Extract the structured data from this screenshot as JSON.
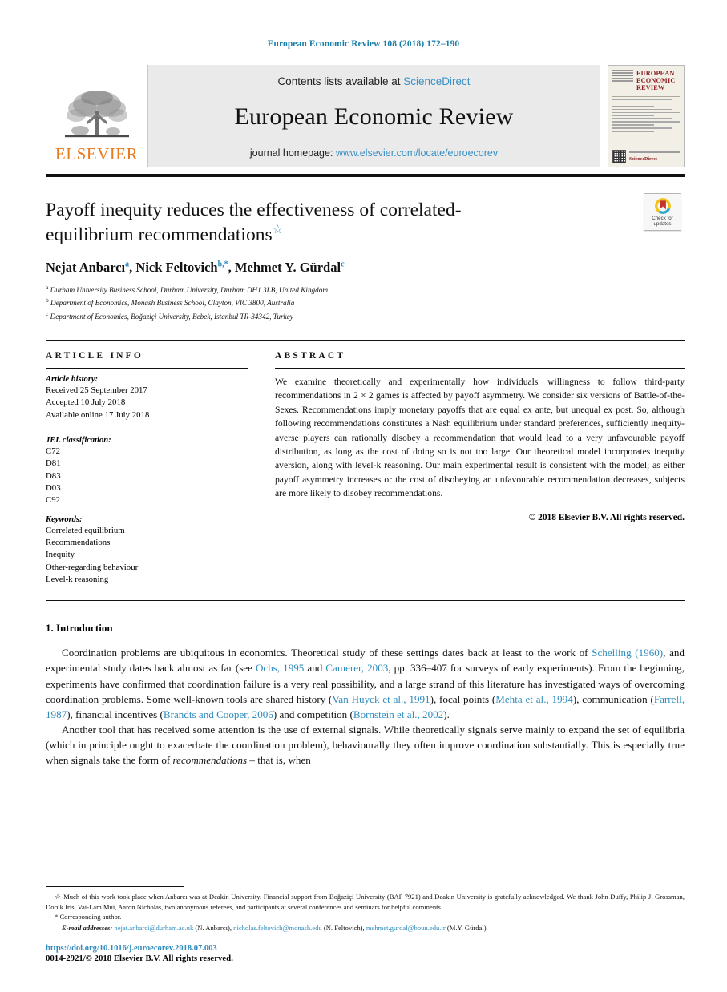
{
  "running_head": "European Economic Review 108 (2018) 172–190",
  "masthead": {
    "publisher_name": "ELSEVIER",
    "contents_prefix": "Contents lists available at ",
    "contents_link": "ScienceDirect",
    "journal_title": "European Economic Review",
    "homepage_prefix": "journal homepage: ",
    "homepage_link": "www.elsevier.com/locate/euroecorev",
    "cover_title": "EUROPEAN ECONOMIC REVIEW",
    "cover_brand": "ScienceDirect"
  },
  "crossmark": {
    "line1": "Check for",
    "line2": "updates"
  },
  "article": {
    "title": "Payoff inequity reduces the effectiveness of correlated-equilibrium recommendations",
    "title_star": "☆",
    "authors": [
      {
        "name": "Nejat Anbarcı",
        "sup": "a"
      },
      {
        "name": "Nick Feltovich",
        "sup": "b,*"
      },
      {
        "name": "Mehmet Y. Gürdal",
        "sup": "c"
      }
    ],
    "affiliations": [
      {
        "mark": "a",
        "text": "Durham University Business School, Durham University, Durham DH1 3LB, United Kingdom"
      },
      {
        "mark": "b",
        "text": "Department of Economics, Monash Business School, Clayton, VIC 3800, Australia"
      },
      {
        "mark": "c",
        "text": "Department of Economics, Boğaziçi University, Bebek, Istanbul TR-34342, Turkey"
      }
    ]
  },
  "info": {
    "heading": "ARTICLE INFO",
    "history_label": "Article history:",
    "history": [
      "Received 25 September 2017",
      "Accepted 10 July 2018",
      "Available online 17 July 2018"
    ],
    "jel_label": "JEL classification:",
    "jel": [
      "C72",
      "D81",
      "D83",
      "D03",
      "C92"
    ],
    "keywords_label": "Keywords:",
    "keywords": [
      "Correlated equilibrium",
      "Recommendations",
      "Inequity",
      "Other-regarding behaviour",
      "Level-k reasoning"
    ]
  },
  "abstract": {
    "heading": "ABSTRACT",
    "text": "We examine theoretically and experimentally how individuals' willingness to follow third-party recommendations in 2 × 2 games is affected by payoff asymmetry. We consider six versions of Battle-of-the-Sexes. Recommendations imply monetary payoffs that are equal ex ante, but unequal ex post. So, although following recommendations constitutes a Nash equilibrium under standard preferences, sufficiently inequity-averse players can rationally disobey a recommendation that would lead to a very unfavourable payoff distribution, as long as the cost of doing so is not too large. Our theoretical model incorporates inequity aversion, along with level-k reasoning. Our main experimental result is consistent with the model; as either payoff asymmetry increases or the cost of disobeying an unfavourable recommendation decreases, subjects are more likely to disobey recommendations.",
    "copyright": "© 2018 Elsevier B.V. All rights reserved."
  },
  "section": {
    "heading": "1. Introduction",
    "para1": {
      "s1": "Coordination problems are ubiquitous in economics. Theoretical study of these settings dates back at least to the work of ",
      "ref1": "Schelling (1960)",
      "s2": ", and experimental study dates back almost as far (see ",
      "ref2": "Ochs, 1995",
      "s3": " and ",
      "ref3": "Camerer, 2003",
      "s4": ", pp. 336–407 for surveys of early experiments). From the beginning, experiments have confirmed that coordination failure is a very real possibility, and a large strand of this literature has investigated ways of overcoming coordination problems. Some well-known tools are shared history (",
      "ref4": "Van Huyck et al., 1991",
      "s5": "), focal points (",
      "ref5": "Mehta et al., 1994",
      "s6": "), communication (",
      "ref6": "Farrell, 1987",
      "s7": "), financial incentives (",
      "ref7": "Brandts and Cooper, 2006",
      "s8": ") and competition (",
      "ref8": "Bornstein et al., 2002",
      "s9": ")."
    },
    "para2": {
      "s1": "Another tool that has received some attention is the use of external signals. While theoretically signals serve mainly to expand the set of equilibria (which in principle ought to exacerbate the coordination problem), behaviourally they often improve coordination substantially. This is especially true when signals take the form of ",
      "ital1": "recommendations",
      "s2": " – that is, when"
    }
  },
  "footnotes": {
    "star_mark": "☆",
    "star_text": "Much of this work took place when Anbarcı was at Deakin University. Financial support from Boğaziçi University (BAP 7921) and Deakin University is gratefully acknowledged. We thank John Duffy, Philip J. Grossman, Doruk Iris, Vai-Lam Mui, Aaron Nicholas, two anonymous referees, and participants at several conferences and seminars for helpful comments.",
    "corresponding_mark": "*",
    "corresponding_text": "Corresponding author.",
    "email_label": "E-mail addresses:",
    "emails": [
      {
        "address": "nejat.anbarci@durham.ac.uk",
        "person": "(N. Anbarcı)"
      },
      {
        "address": "nicholas.feltovich@monash.edu",
        "person": "(N. Feltovich)"
      },
      {
        "address": "mehmet.gurdal@boun.edu.tr",
        "person": "(M.Y. Gürdal)"
      }
    ]
  },
  "footer": {
    "doi": "https://doi.org/10.1016/j.euroecorev.2018.07.003",
    "issn_line": "0014-2921/© 2018 Elsevier B.V. All rights reserved."
  },
  "colors": {
    "link": "#2e8bbd",
    "elsevier_orange": "#E77B20",
    "cover_red": "#8d1b20"
  }
}
